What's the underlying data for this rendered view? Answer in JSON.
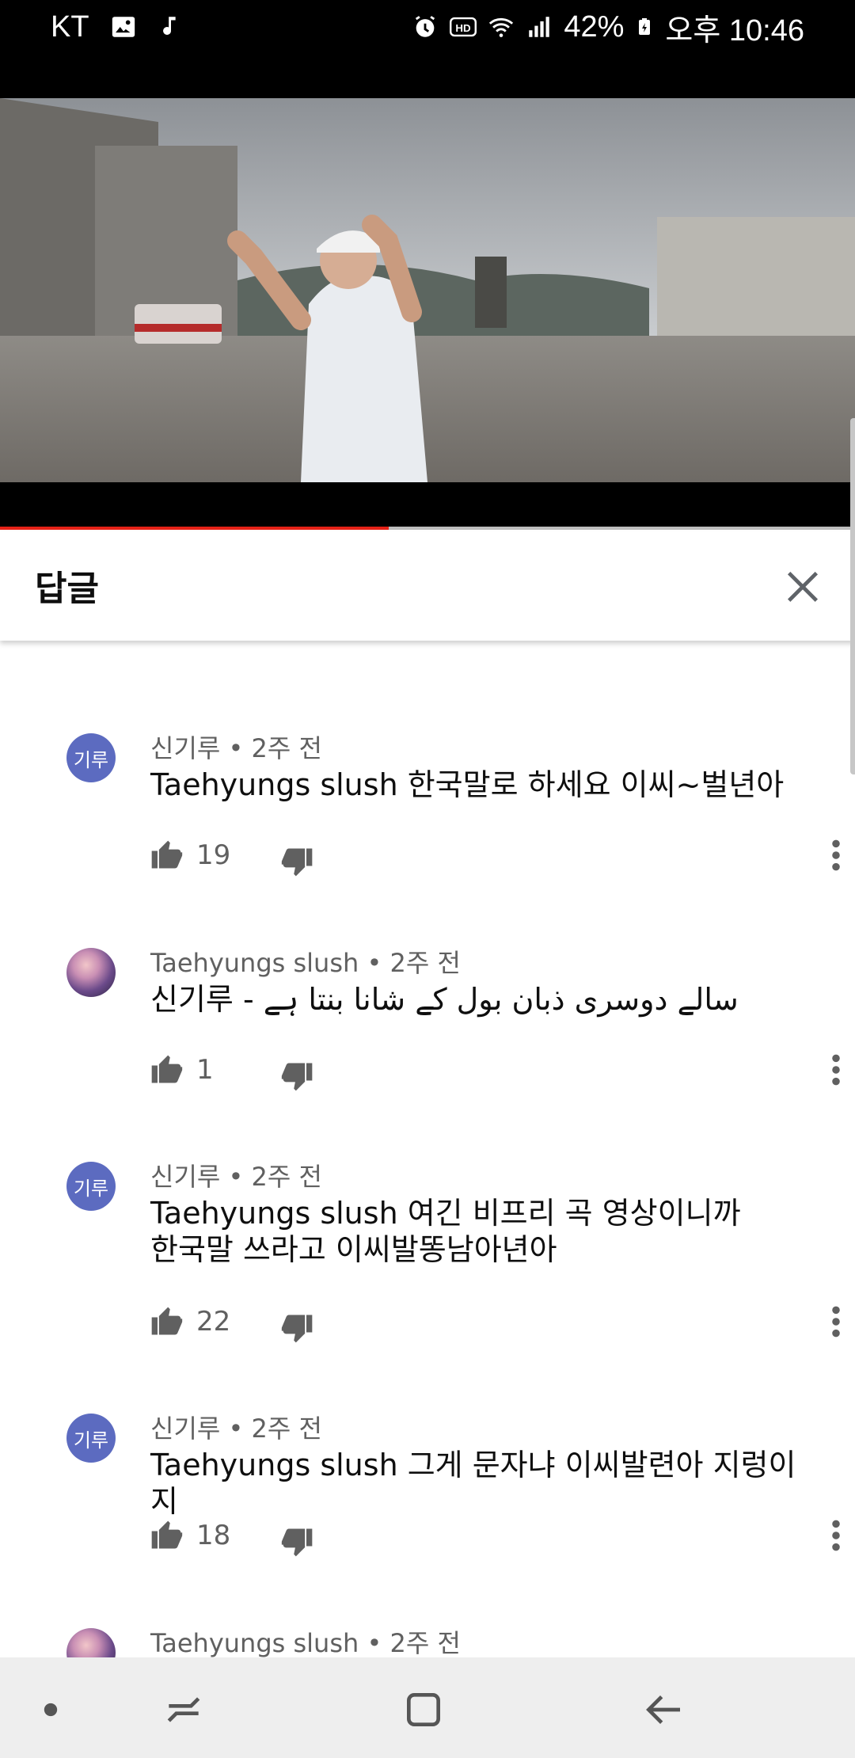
{
  "status_bar": {
    "carrier": "KT",
    "battery": "42%",
    "time": "오후 10:46",
    "icons": [
      "image-icon",
      "music-icon",
      "alarm-icon",
      "hd-icon",
      "wifi-icon",
      "signal-icon",
      "battery-icon"
    ]
  },
  "video": {
    "progress_fraction": 0.455,
    "progress_color": "#e62117"
  },
  "replies": {
    "title": "답글",
    "close_icon": "close-icon"
  },
  "comments": [
    {
      "avatar_type": "initials",
      "avatar_text": "기루",
      "author": "신기루",
      "time": "2주 전",
      "text": "Taehyungs slush 한국말로 하세요 이씨~벌년아",
      "likes": "19"
    },
    {
      "avatar_type": "photo",
      "avatar_text": "",
      "author": "Taehyungs slush",
      "time": "2주 전",
      "text": "신기루 - سالے دوسری ذبان بول کے شانا بنتا ہے",
      "likes": "1"
    },
    {
      "avatar_type": "initials",
      "avatar_text": "기루",
      "author": "신기루",
      "time": "2주 전",
      "text": "Taehyungs slush 여긴 비프리 곡 영상이니까\n한국말 쓰라고 이씨발똥남아년아",
      "likes": "22"
    },
    {
      "avatar_type": "initials",
      "avatar_text": "기루",
      "author": "신기루",
      "time": "2주 전",
      "text": "Taehyungs slush 그게 문자냐 이씨발련아 지렁이지",
      "likes": "18"
    },
    {
      "avatar_type": "photo",
      "avatar_text": "",
      "author": "Taehyungs slush",
      "time": "2주 전",
      "text": "",
      "likes": ""
    }
  ],
  "meta_separator": " • ",
  "colors": {
    "accent_red": "#e62117",
    "avatar_blue": "#5c6bc0",
    "meta_gray": "#606060"
  }
}
